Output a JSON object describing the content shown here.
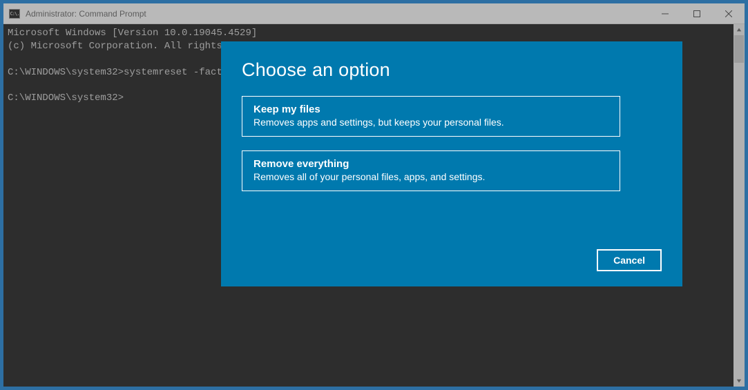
{
  "window": {
    "title": "Administrator: Command Prompt",
    "icon_text": "C:\\."
  },
  "console": {
    "line1": "Microsoft Windows [Version 10.0.19045.4529]",
    "line2": "(c) Microsoft Corporation. All rights r",
    "line3": "C:\\WINDOWS\\system32>systemreset -factor",
    "line4": "C:\\WINDOWS\\system32>"
  },
  "dialog": {
    "title": "Choose an option",
    "options": [
      {
        "title": "Keep my files",
        "desc": "Removes apps and settings, but keeps your personal files."
      },
      {
        "title": "Remove everything",
        "desc": "Removes all of your personal files, apps, and settings."
      }
    ],
    "cancel_label": "Cancel"
  }
}
